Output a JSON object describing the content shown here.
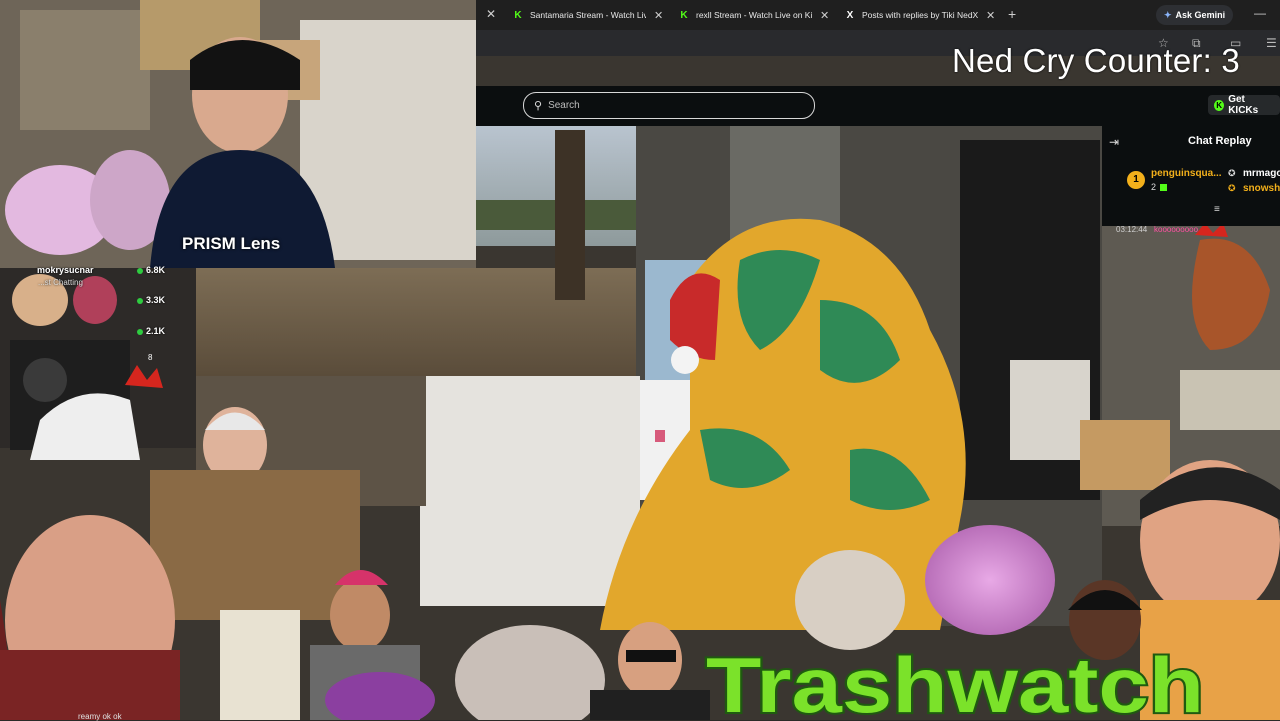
{
  "browser": {
    "tabs": [
      {
        "title": "Santamaria Stream - Watch Live",
        "favicon": "kick-icon"
      },
      {
        "title": "rexll Stream - Watch Live on Kick",
        "favicon": "kick-icon"
      },
      {
        "title": "Posts with replies by Tiki NedX",
        "favicon": "x-icon"
      }
    ],
    "new_tab_symbol": "+",
    "gemini_label": "Ask Gemini"
  },
  "overlay": {
    "counter_text": "Ned Cry Counter: 3"
  },
  "kick": {
    "search_placeholder": "Search",
    "get_kicks_label": "Get KICKs"
  },
  "chat": {
    "title": "Chat Replay",
    "top_gifters": [
      {
        "rank": "1",
        "name": "penguinsqua...",
        "count": "2"
      },
      {
        "name": "mrmago"
      },
      {
        "name": "snowsh"
      }
    ],
    "message": {
      "time": "03:12:44",
      "user": "kooooooooo"
    }
  },
  "webcam_overlay": {
    "shirt_text": "PRISM Lens",
    "leaderboard": {
      "name": "mokrysucnar",
      "category": "...st Chatting",
      "stats": [
        "6.8K",
        "3.3K",
        "2.1K"
      ],
      "partial": "8"
    },
    "bottom_caption": "reamy ok ok"
  },
  "logo_text": "Trashwatch",
  "colors": {
    "kick_green": "#53fc18",
    "gold": "#f3b01b",
    "logo_green": "#7be22a"
  }
}
